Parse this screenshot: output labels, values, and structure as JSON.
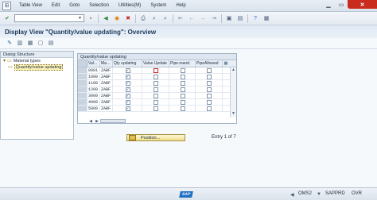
{
  "menu": {
    "items": [
      "Table View",
      "Edit",
      "Goto",
      "Selection",
      "Utilities(M)",
      "System",
      "Help"
    ]
  },
  "toolbar": {
    "command_value": "",
    "icons": [
      "enter-icon",
      "save-icon",
      "back-icon",
      "exit-icon",
      "cancel-icon",
      "print-icon",
      "find-icon",
      "find-next-icon",
      "first-page-icon",
      "prev-page-icon",
      "next-page-icon",
      "last-page-icon",
      "new-session-icon",
      "shortcut-icon",
      "help-icon",
      "layout-icon"
    ]
  },
  "title": "Display View \"Quantity/value updating\": Overview",
  "dialog": {
    "header": "Dialog Structure",
    "root": "Material types",
    "child": "Quantity/value updating"
  },
  "table": {
    "caption": "Quantity/value updating",
    "columns": [
      "Val...",
      "Ma...",
      "Qty updating",
      "Value Update",
      "Pipe.mand.",
      "PipeAllowed"
    ],
    "rows": [
      {
        "val": "0001",
        "ma": "ZABF",
        "qty": true,
        "upd": false,
        "pm": false,
        "pa": false
      },
      {
        "val": "1000",
        "ma": "ZABF",
        "qty": true,
        "upd": false,
        "pm": false,
        "pa": false
      },
      {
        "val": "1100",
        "ma": "ZABF",
        "qty": true,
        "upd": false,
        "pm": false,
        "pa": false
      },
      {
        "val": "1200",
        "ma": "ZABF",
        "qty": true,
        "upd": false,
        "pm": false,
        "pa": false
      },
      {
        "val": "3000",
        "ma": "ZABF",
        "qty": true,
        "upd": false,
        "pm": false,
        "pa": false
      },
      {
        "val": "4000",
        "ma": "ZABF",
        "qty": true,
        "upd": false,
        "pm": false,
        "pa": false
      },
      {
        "val": "5000",
        "ma": "ZABF",
        "qty": true,
        "upd": false,
        "pm": false,
        "pa": false
      }
    ]
  },
  "position_button": "Position...",
  "entry_text": "Entry 1 of 7",
  "status": {
    "logo": "SAP",
    "system": "OMS2",
    "server": "SAPPRD",
    "mode": "OVR"
  },
  "colors": {
    "title_text": "#1b3a5c",
    "close_button": "#c92b1c",
    "highlight": "#fff3b8"
  }
}
